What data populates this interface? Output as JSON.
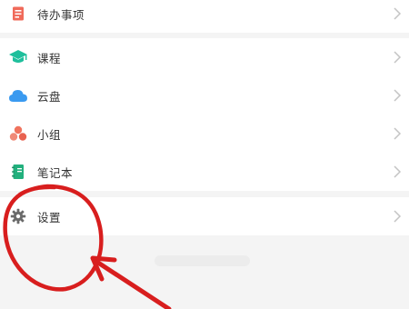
{
  "menu": {
    "items": [
      {
        "label": "待办事项",
        "icon": "todo-icon",
        "color": "#f06a5a"
      },
      {
        "label": "课程",
        "icon": "graduation-cap-icon",
        "color": "#1fbf9c"
      },
      {
        "label": "云盘",
        "icon": "cloud-icon",
        "color": "#3a9af0"
      },
      {
        "label": "小组",
        "icon": "group-icon",
        "color": "#f0735e"
      },
      {
        "label": "笔记本",
        "icon": "notebook-icon",
        "color": "#22b07d"
      }
    ],
    "settings": {
      "label": "设置",
      "icon": "gear-icon",
      "color": "#6a6a6a"
    }
  },
  "colors": {
    "annotation": "#d81e1e",
    "chevron": "#c4c4c4",
    "divider": "#f4f4f4"
  }
}
